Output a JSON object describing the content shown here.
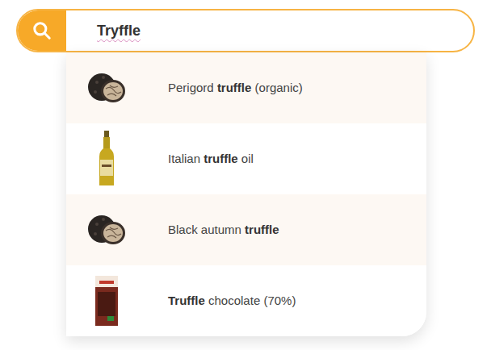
{
  "search": {
    "value": "Tryffle",
    "misspelled": true
  },
  "suggestions": [
    {
      "kind": "truffle",
      "selected": true,
      "parts": [
        {
          "text": "Perigord ",
          "bold": false
        },
        {
          "text": "truffle",
          "bold": true
        },
        {
          "text": " (organic)",
          "bold": false
        }
      ]
    },
    {
      "kind": "oil",
      "selected": false,
      "parts": [
        {
          "text": "Italian ",
          "bold": false
        },
        {
          "text": "truffle",
          "bold": true
        },
        {
          "text": " oil",
          "bold": false
        }
      ]
    },
    {
      "kind": "truffle",
      "selected": true,
      "parts": [
        {
          "text": "Black autumn ",
          "bold": false
        },
        {
          "text": "truffle",
          "bold": true
        }
      ]
    },
    {
      "kind": "chocolate",
      "selected": false,
      "parts": [
        {
          "text": "Truffle",
          "bold": true
        },
        {
          "text": " chocolate (70%)",
          "bold": false
        }
      ]
    }
  ]
}
